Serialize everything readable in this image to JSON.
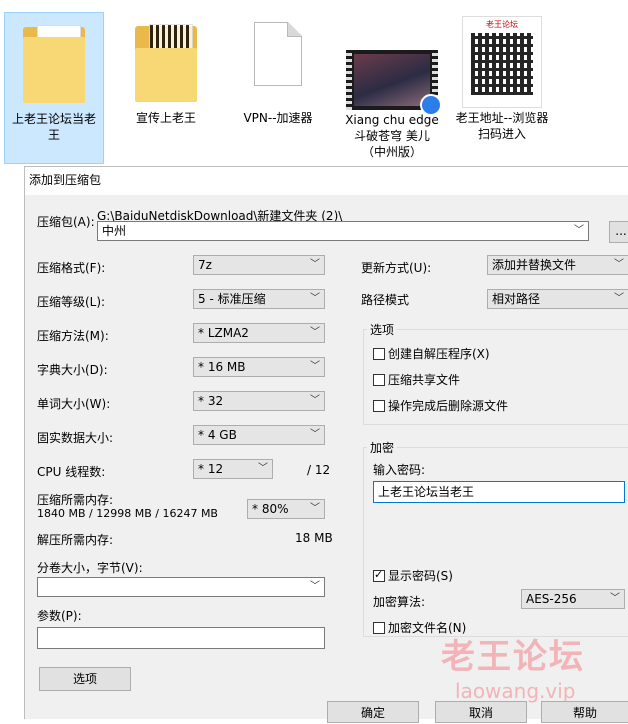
{
  "desktop": {
    "icons": [
      {
        "label": "上老王论坛当老王"
      },
      {
        "label": "宣传上老王"
      },
      {
        "label": "VPN--加速器"
      },
      {
        "label": "Xiang chu edge 斗破苍穹 美儿 （中州版）"
      },
      {
        "label": "老王地址--浏览器扫码进入",
        "thumb_header": "老王论坛"
      }
    ]
  },
  "dialog": {
    "title": "添加到压缩包",
    "archive": {
      "label": "压缩包(A):",
      "path": "G:\\BaiduNetdiskDownload\\新建文件夹 (2)\\",
      "name": "中州",
      "browse_label": "..."
    },
    "left": {
      "format": {
        "label": "压缩格式(F):",
        "value": "7z"
      },
      "level": {
        "label": "压缩等级(L):",
        "value": "5 - 标准压缩"
      },
      "method": {
        "label": "压缩方法(M):",
        "value": "* LZMA2"
      },
      "dict": {
        "label": "字典大小(D):",
        "value": "* 16 MB"
      },
      "word": {
        "label": "单词大小(W):",
        "value": "* 32"
      },
      "solid": {
        "label": "固实数据大小:",
        "value": "* 4 GB"
      },
      "threads": {
        "label": "CPU 线程数:",
        "value": "* 12",
        "max": "/ 12"
      },
      "mem_compress": {
        "label": "压缩所需内存:",
        "detail": "1840 MB / 12998 MB / 16247 MB",
        "value": "* 80%"
      },
      "mem_decompress": {
        "label": "解压所需内存:",
        "value": "18 MB"
      },
      "volume": {
        "label": "分卷大小，字节(V):",
        "value": ""
      },
      "params": {
        "label": "参数(P):",
        "value": ""
      },
      "options_button": "选项"
    },
    "right": {
      "update": {
        "label": "更新方式(U):",
        "value": "添加并替换文件"
      },
      "pathmode": {
        "label": "路径模式",
        "value": "相对路径"
      },
      "options_group": {
        "title": "选项",
        "items": [
          {
            "label": "创建自解压程序(X)",
            "checked": false
          },
          {
            "label": "压缩共享文件",
            "checked": false
          },
          {
            "label": "操作完成后删除源文件",
            "checked": false
          }
        ]
      },
      "encrypt_group": {
        "title": "加密",
        "password_label": "输入密码:",
        "password_value": "上老王论坛当老王",
        "show_password": {
          "label": "显示密码(S)",
          "checked": true
        },
        "algo": {
          "label": "加密算法:",
          "value": "AES-256"
        },
        "encrypt_names": {
          "label": "加密文件名(N)",
          "checked": false
        }
      }
    },
    "buttons": {
      "ok": "确定",
      "cancel": "取消",
      "help": "帮助"
    }
  },
  "watermark": {
    "title": "老王论坛",
    "url": "laowang.vip"
  },
  "colors": {
    "selection": "#cce8ff",
    "dialog_bg": "#f0f0f0",
    "focus_border": "#0078d7",
    "watermark": "#f3a0a5"
  }
}
